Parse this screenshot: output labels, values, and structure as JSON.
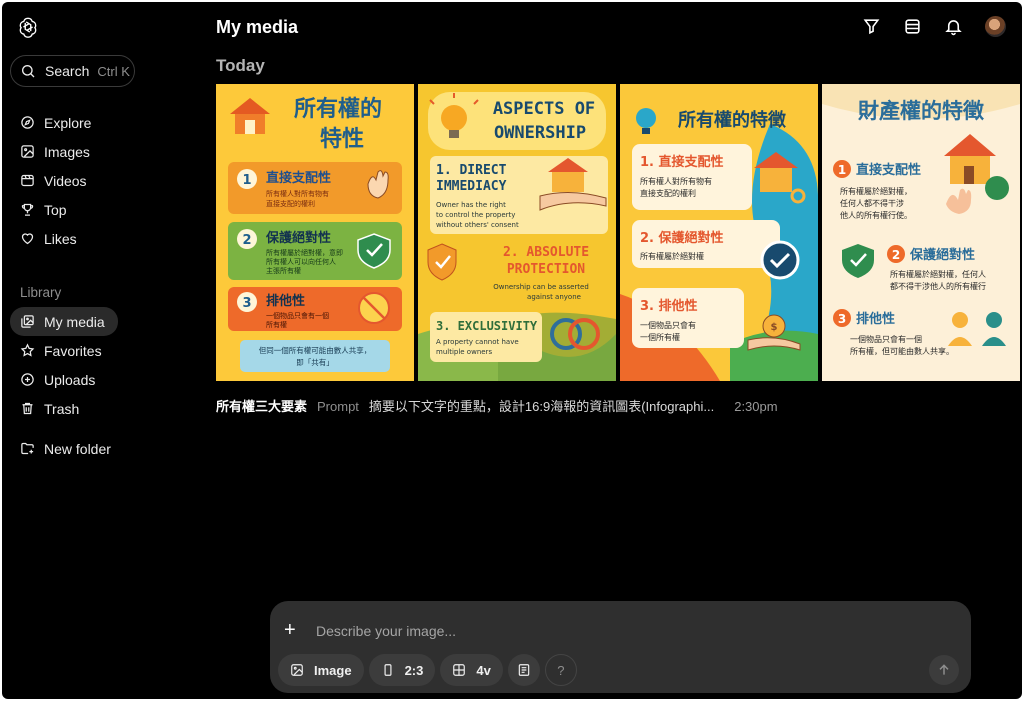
{
  "sidebar": {
    "search_label": "Search",
    "search_shortcut": "Ctrl K",
    "items": [
      {
        "label": "Explore",
        "icon": "compass-icon"
      },
      {
        "label": "Images",
        "icon": "image-icon"
      },
      {
        "label": "Videos",
        "icon": "video-icon"
      },
      {
        "label": "Top",
        "icon": "trophy-icon"
      },
      {
        "label": "Likes",
        "icon": "heart-icon"
      }
    ],
    "library_label": "Library",
    "library_items": [
      {
        "label": "My media",
        "icon": "my-media-icon",
        "active": true
      },
      {
        "label": "Favorites",
        "icon": "star-icon"
      },
      {
        "label": "Uploads",
        "icon": "plus-circle-icon"
      },
      {
        "label": "Trash",
        "icon": "trash-icon"
      }
    ],
    "new_folder_label": "New folder"
  },
  "header": {
    "title": "My media",
    "icons": [
      "filter-icon",
      "list-view-icon",
      "bell-icon",
      "avatar"
    ]
  },
  "main": {
    "day_label": "Today",
    "tiles": [
      {
        "title_lines": [
          "所有權的",
          "特性"
        ],
        "items": [
          {
            "num": "1",
            "heading": "直接支配性",
            "body": [
              "所有權人對所有物有",
              "直接支配的權利"
            ]
          },
          {
            "num": "2",
            "heading": "保護絕對性",
            "body": [
              "所有權屬於絕對權，意即",
              "所有權人可以向任何人",
              "主張所有權"
            ]
          },
          {
            "num": "3",
            "heading": "排他性",
            "body": [
              "一個物品只會有一個",
              "所有權"
            ]
          }
        ],
        "footer": [
          "但同一個所有權可能由數人共享，",
          "即「共有」"
        ]
      },
      {
        "title_lines": [
          "ASPECTS OF",
          "OWNERSHIP"
        ],
        "items": [
          {
            "heading": "1. DIRECT",
            "heading2": "IMMEDIACY",
            "body": [
              "Owner has the right",
              "to control the property",
              "without others' consent"
            ]
          },
          {
            "heading": "2. ABSOLUTE",
            "heading2": "PROTECTION",
            "body": [
              "Ownership can be asserted",
              "against anyone"
            ]
          },
          {
            "heading": "3. EXCLUSIVITY",
            "body": [
              "A property cannot have",
              "multiple owners"
            ]
          }
        ]
      },
      {
        "title": "所有權的特徵",
        "items": [
          {
            "heading": "1. 直接支配性",
            "body": [
              "所有權人對所有物有",
              "直接支配的權利"
            ]
          },
          {
            "heading": "2. 保護絕對性",
            "body": [
              "所有權屬於絕對權"
            ]
          },
          {
            "heading": "3. 排他性",
            "body": [
              "一個物品只會有",
              "一個所有權"
            ]
          }
        ]
      },
      {
        "title": "財產權的特徵",
        "items": [
          {
            "num": "1",
            "heading": "直接支配性",
            "body": [
              "所有權屬於絕對權，",
              "任何人都不得干涉",
              "他人的所有權行使。"
            ]
          },
          {
            "num": "2",
            "heading": "保護絕對性",
            "body": [
              "所有權屬於絕對權，任何人",
              "都不得干涉他人的所有權行"
            ]
          },
          {
            "num": "3",
            "heading": "排他性",
            "body": [
              "一個物品只會有一個",
              "所有權，但可能由數人共享。"
            ]
          }
        ]
      }
    ],
    "meta": {
      "title": "所有權三大要素",
      "prompt_label": "Prompt",
      "prompt_text": "摘要以下文字的重點，設計16:9海報的資訊圖表(Infographi...",
      "time": "2:30pm"
    }
  },
  "composer": {
    "placeholder": "Describe your image...",
    "mode_label": "Image",
    "ratio_label": "2:3",
    "variants_label": "4v",
    "help_label": "?"
  }
}
